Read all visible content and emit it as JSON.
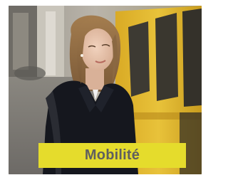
{
  "tile": {
    "label": "Mobilité",
    "image_subject": "woman-on-train-platform"
  },
  "colors": {
    "caption_background": "#e5dc2c",
    "caption_text": "#5f5f5f",
    "train_yellow": "#e3b82c",
    "coat": "#15171e"
  }
}
